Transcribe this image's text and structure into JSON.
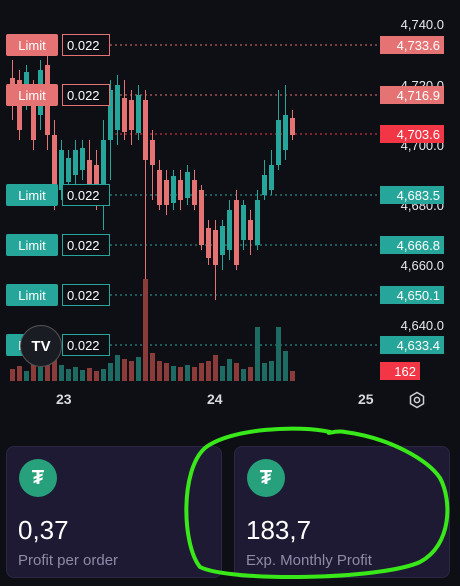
{
  "colors": {
    "up": "#26a69a",
    "down": "#e57373",
    "volume_up": "#1d6b62",
    "volume_down": "#8b3b3a",
    "highlight": "#39e819"
  },
  "price_axis": [
    "4,740.0",
    "4,720.0",
    "4,700.0",
    "4,680.0",
    "4,660.0",
    "4,640.0"
  ],
  "order_lines": [
    {
      "side": "sell",
      "label": "Limit",
      "qty": "0.022",
      "price": "4,733.6"
    },
    {
      "side": "sell",
      "label": "Limit",
      "qty": "0.022",
      "price": "4,716.9"
    },
    {
      "side": "buy",
      "label": "Limit",
      "qty": "0.022",
      "price": "4,683.5"
    },
    {
      "side": "buy",
      "label": "Limit",
      "qty": "0.022",
      "price": "4,666.8"
    },
    {
      "side": "buy",
      "label": "Limit",
      "qty": "0.022",
      "price": "4,650.1"
    },
    {
      "side": "buy",
      "label": "Limit",
      "qty": "0.022",
      "price": "4,633.4"
    }
  ],
  "current_price": "4,703.6",
  "volume_tag": "162",
  "dates": [
    "23",
    "24",
    "25"
  ],
  "logo_text": "TV",
  "settings_icon": "gear-icon",
  "cards": [
    {
      "icon": "tether-icon",
      "value": "0,37",
      "label": "Profit per order"
    },
    {
      "icon": "tether-icon",
      "value": "183,7",
      "label": "Exp. Monthly Profit"
    }
  ]
}
